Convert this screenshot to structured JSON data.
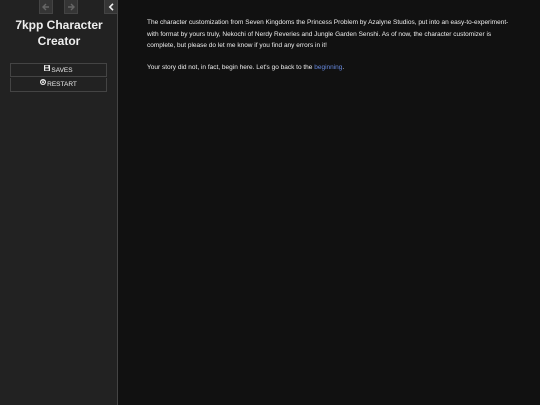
{
  "sidebar": {
    "title_line1": "7kpp Character",
    "title_line2": "Creator",
    "menu": {
      "saves_label": "Saves",
      "restart_label": "Restart"
    },
    "icons": {
      "history_back": "arrow-left-icon",
      "history_forward": "arrow-right-icon",
      "collapse": "chevron-left-icon",
      "saves": "floppy-disk-icon",
      "restart": "power-icon"
    }
  },
  "passage": {
    "paragraph1": "The character customization from Seven Kingdoms the Princess Problem by Azalyne Studios, put into an easy-to-experiment-with format by yours truly, Nekochi of Nerdy Reveries and Jungle Garden Senshi. As of now, the character customizer is complete, but please do let me know if you find any errors in it!",
    "paragraph2_before": "Your story did not, in fact, begin here. Let's go back to the ",
    "paragraph2_link": "beginning",
    "paragraph2_after": "."
  },
  "colors": {
    "background": "#111111",
    "sidebar": "#222222",
    "text": "#eeeeee",
    "link": "#6688dd"
  }
}
